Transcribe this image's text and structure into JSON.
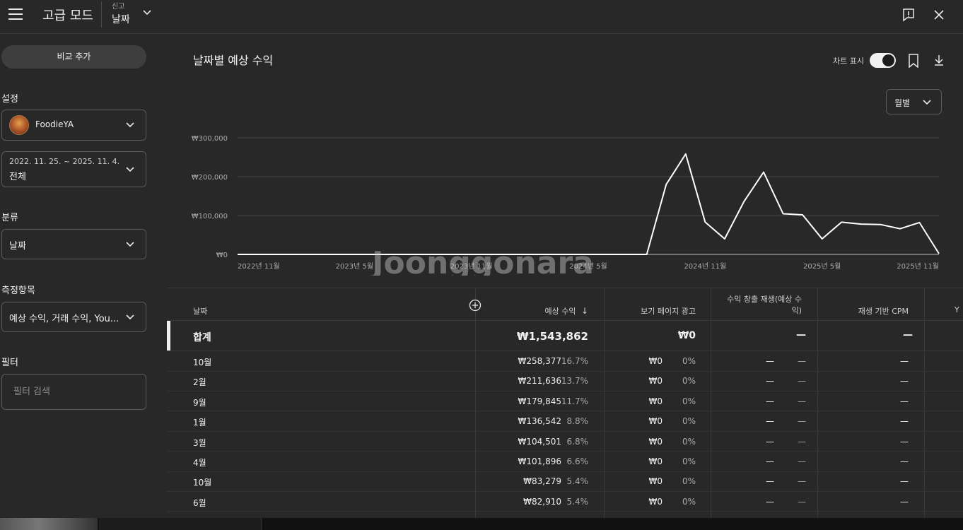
{
  "topbar": {
    "title": "고급 모드",
    "report_label": "신고",
    "report_value": "날짜"
  },
  "sidebar": {
    "compare_button": "비교 추가",
    "settings_label": "설정",
    "channel_name": "FoodieYA",
    "date_range": "2022. 11. 25. ~ 2025. 11. 4.",
    "date_preset": "전체",
    "category_label": "분류",
    "category_value": "날짜",
    "metrics_label": "측정항목",
    "metrics_value": "예상 수익, 거래 수익, You...",
    "filter_label": "필터",
    "filter_placeholder": "필터 검색"
  },
  "main": {
    "title": "날짜별 예상 수익",
    "chart_toggle_label": "차트 표시",
    "period": "월별"
  },
  "chart_data": {
    "type": "line",
    "y_ticks": [
      "₩300,000",
      "₩200,000",
      "₩100,000",
      "₩0"
    ],
    "ylim": [
      0,
      300000
    ],
    "x_tick_labels": [
      "2022년 11월",
      "2023년 5월",
      "2023년 11월",
      "2024년 5월",
      "2024년 11월",
      "2025년 5월",
      "2025년 11월"
    ],
    "x": [
      "2022-11",
      "2022-12",
      "2023-01",
      "2023-02",
      "2023-03",
      "2023-04",
      "2023-05",
      "2023-06",
      "2023-07",
      "2023-08",
      "2023-09",
      "2023-10",
      "2023-11",
      "2023-12",
      "2024-01",
      "2024-02",
      "2024-03",
      "2024-04",
      "2024-05",
      "2024-06",
      "2024-07",
      "2024-08",
      "2024-09",
      "2024-10",
      "2024-11",
      "2024-12",
      "2025-01",
      "2025-02",
      "2025-03",
      "2025-04",
      "2025-05",
      "2025-06",
      "2025-07",
      "2025-08",
      "2025-09",
      "2025-10",
      "2025-11"
    ],
    "series": [
      {
        "values": [
          0,
          0,
          0,
          0,
          0,
          0,
          0,
          0,
          0,
          0,
          0,
          0,
          0,
          0,
          0,
          0,
          0,
          0,
          0,
          0,
          0,
          0,
          179845,
          258377,
          83279,
          40000,
          136542,
          211636,
          104501,
          101896,
          40000,
          82910,
          78000,
          77000,
          66000,
          82000,
          2000
        ]
      }
    ],
    "grid": true,
    "line_color": "#ffffff"
  },
  "table": {
    "headers": {
      "date": "날짜",
      "revenue": "예상 수익",
      "watch_page_ads": "보기 페이지 광고",
      "monetized_playbacks": "수익 창출 재생(예상 수익)",
      "playback_cpm": "재생 기반 CPM",
      "partial": "Y"
    },
    "total": {
      "label": "합계",
      "revenue": "₩1,543,862",
      "ads": "₩0",
      "playbacks": "—",
      "cpm": "—"
    },
    "rows": [
      {
        "date": "10월",
        "revenue": "₩258,377",
        "pct": "16.7%",
        "ads": "₩0",
        "ads_pct": "0%",
        "play": "—",
        "play_pct": "—",
        "cpm": "—"
      },
      {
        "date": "2월",
        "revenue": "₩211,636",
        "pct": "13.7%",
        "ads": "₩0",
        "ads_pct": "0%",
        "play": "—",
        "play_pct": "—",
        "cpm": "—"
      },
      {
        "date": "9월",
        "revenue": "₩179,845",
        "pct": "11.7%",
        "ads": "₩0",
        "ads_pct": "0%",
        "play": "—",
        "play_pct": "—",
        "cpm": "—"
      },
      {
        "date": "1월",
        "revenue": "₩136,542",
        "pct": "8.8%",
        "ads": "₩0",
        "ads_pct": "0%",
        "play": "—",
        "play_pct": "—",
        "cpm": "—"
      },
      {
        "date": "3월",
        "revenue": "₩104,501",
        "pct": "6.8%",
        "ads": "₩0",
        "ads_pct": "0%",
        "play": "—",
        "play_pct": "—",
        "cpm": "—"
      },
      {
        "date": "4월",
        "revenue": "₩101,896",
        "pct": "6.6%",
        "ads": "₩0",
        "ads_pct": "0%",
        "play": "—",
        "play_pct": "—",
        "cpm": "—"
      },
      {
        "date": "10월",
        "revenue": "₩83,279",
        "pct": "5.4%",
        "ads": "₩0",
        "ads_pct": "0%",
        "play": "—",
        "play_pct": "—",
        "cpm": "—"
      },
      {
        "date": "6월",
        "revenue": "₩82,910",
        "pct": "5.4%",
        "ads": "₩0",
        "ads_pct": "0%",
        "play": "—",
        "play_pct": "—",
        "cpm": "—"
      }
    ]
  },
  "watermark": "Joonggonara"
}
